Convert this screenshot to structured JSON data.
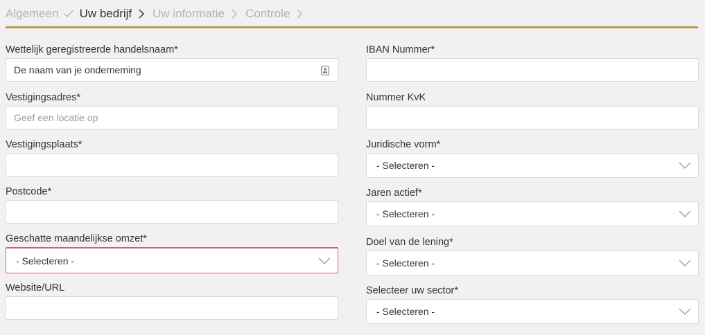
{
  "steps": [
    {
      "label": "Algemeen",
      "state": "done"
    },
    {
      "label": "Uw bedrijf",
      "state": "active"
    },
    {
      "label": "Uw informatie",
      "state": "upcoming"
    },
    {
      "label": "Controle",
      "state": "upcoming"
    }
  ],
  "colors": {
    "accent_rule": "#b59a52",
    "error_border": "#e3585e",
    "page_bg": "#f1f1f1"
  },
  "form": {
    "left": {
      "trade_name": {
        "label": "Wettelijk geregistreerde handelsnaam*",
        "value": "De naam van je onderneming",
        "icon": "contact-card-icon"
      },
      "address": {
        "label": "Vestigingsadres*",
        "placeholder": "Geef een locatie op"
      },
      "city": {
        "label": "Vestigingsplaats*",
        "value": ""
      },
      "postcode": {
        "label": "Postcode*",
        "value": ""
      },
      "turnover": {
        "label": "Geschatte maandelijkse omzet*",
        "selected": "- Selecteren -",
        "state": "error"
      },
      "website": {
        "label": "Website/URL",
        "value": ""
      }
    },
    "right": {
      "iban": {
        "label": "IBAN Nummer*",
        "value": ""
      },
      "kvk": {
        "label": "Nummer KvK",
        "value": ""
      },
      "legal_form": {
        "label": "Juridische vorm*",
        "selected": "- Selecteren -"
      },
      "years_active": {
        "label": "Jaren actief*",
        "selected": "- Selecteren -"
      },
      "loan_purpose": {
        "label": "Doel van de lening*",
        "selected": "- Selecteren -"
      },
      "sector": {
        "label": "Selecteer uw sector*",
        "selected": "- Selecteren -"
      }
    }
  }
}
